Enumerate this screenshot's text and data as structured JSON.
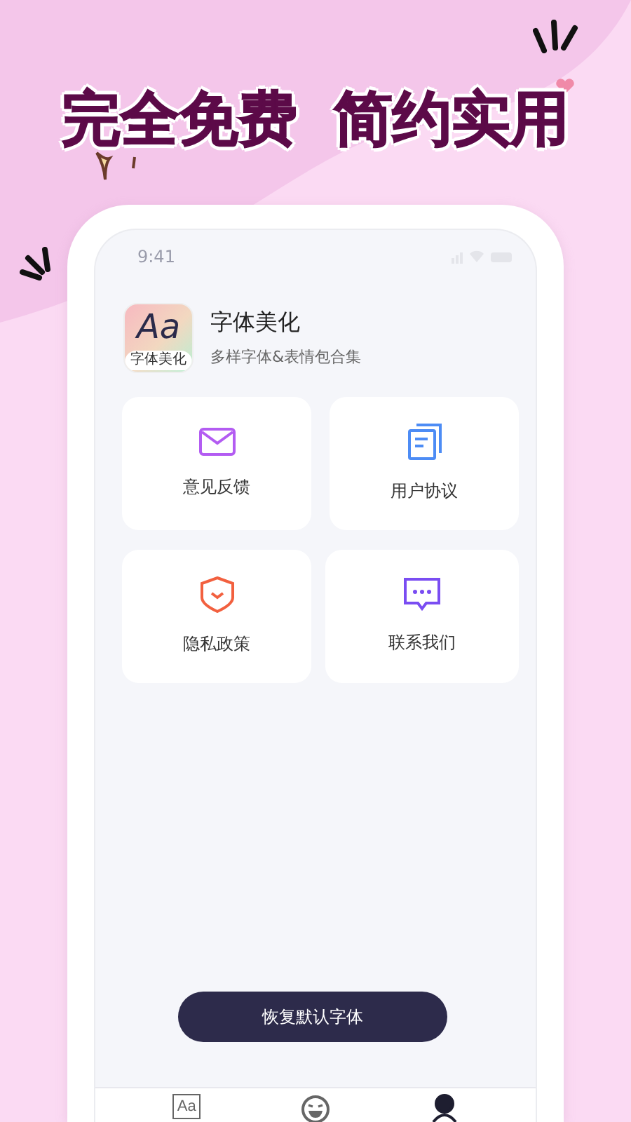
{
  "headline": [
    "完全免费",
    "简约实用"
  ],
  "status_bar": {
    "time": "9:41"
  },
  "app": {
    "icon_text": "Aa",
    "icon_caption": "字体美化",
    "title": "字体美化",
    "subtitle": "多样字体&表情包合集"
  },
  "cards": [
    {
      "label": "意见反馈",
      "kind": "mail"
    },
    {
      "label": "用户协议",
      "kind": "document"
    },
    {
      "label": "隐私政策",
      "kind": "shield"
    },
    {
      "label": "联系我们",
      "kind": "chat"
    }
  ],
  "restore_button": "恢复默认字体",
  "tabs": [
    {
      "kind": "font",
      "glyph": "Aa",
      "selected": false
    },
    {
      "kind": "emoji",
      "selected": false
    },
    {
      "kind": "profile",
      "selected": true
    }
  ]
}
